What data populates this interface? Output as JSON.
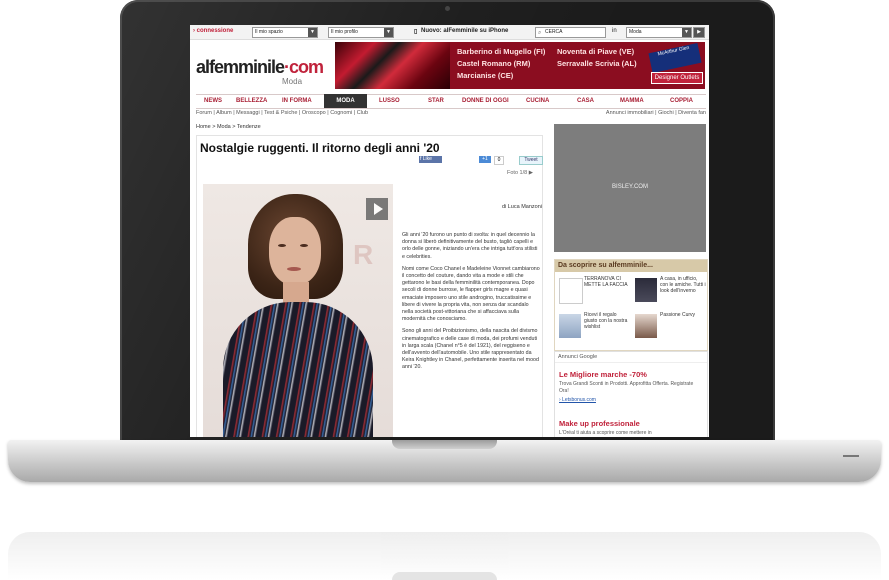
{
  "topbar": {
    "connect": "› connessione",
    "my_space": "Il mio spazio",
    "my_profile": "Il mio profilo",
    "iphone": "Nuovo: alFemminile su iPhone",
    "search": "CERCA",
    "in_label": "in",
    "category": "Moda"
  },
  "logo": {
    "text_a": "al",
    "text_b": "femminile",
    "text_c": "·com",
    "sub": "Moda"
  },
  "banner": {
    "line1a": "Barberino di Mugello (FI)",
    "line2a": "Castel Romano (RM)",
    "line3a": "Marcianise (CE)",
    "line1b": "Noventa di Piave (VE)",
    "line2b": "Serravalle Scrivia (AL)",
    "brand": "McArthur Glen",
    "outlet": "Designer Outlets"
  },
  "nav": [
    "NEWS",
    "BELLEZZA",
    "IN FORMA",
    "MODA",
    "LUSSO",
    "STAR",
    "DONNE DI OGGI",
    "CUCINA",
    "CASA",
    "MAMMA",
    "COPPIA"
  ],
  "subnav": {
    "left": "Forum | Album | Messaggi | Test & Psiche | Oroscopo | Cognomi | Club",
    "right": "Annunci immobiliari | Giochi | Diventa fan"
  },
  "breadcrumb": "Home > Moda > Tendenze",
  "article": {
    "title": "Nostalgie ruggenti. Il ritorno degli anni '20",
    "like": "Like",
    "plus_one": "+1",
    "plus_count": "0",
    "tweet": "Tweet",
    "foto": "Foto 1/8 ▶",
    "author": "di Luca Manzoni",
    "p1": "Gli anni '20 furono un punto di svolta: in quel decennio la donna si liberò definitivamente del busto, tagliò capelli e orlo delle gonne, iniziando un'era che intriga tutt'ora stilisti e celebrities.",
    "p2": "Nomi come Coco Chanel e Madeleine Vionnet cambiarono il concetto del couture, dando vita a mode e stili che gettarono le basi della femminilità contemporanea. Dopo secoli di donne burrose, le flapper girls magre e quasi emaciate imposero uno stile androgino, truccatissime e libere di vivere la propria vita, non senza dar scandalo nella società post-vittoriana che si affacciava sulla modernità che conosciamo.",
    "p3": "Sono gli anni del Proibizionismo, della nascita del divismo cinematografico e delle case di moda, dei profumi venduti in larga scala (Chanel n°5 è del 1921), del reggiseno e dell'avvento dell'automobile. Uno stile rappresentato da Keira Knightley in Chanel, perfettamente inserita nel mood anni '20."
  },
  "ad": {
    "label": "BISLEY.COM"
  },
  "discover": {
    "title": "Da scoprire su alfemminile...",
    "items": [
      {
        "text": "TERRANOVA CI METTE LA FACCIA"
      },
      {
        "text": "A casa, in ufficio, con le amiche. Tutti i look dell'inverno"
      },
      {
        "text": "Ricevi il regalo giusto con la nostra wishlist"
      },
      {
        "text": "Passione Curvy"
      }
    ]
  },
  "google": {
    "head": "Annunci Google",
    "t1": "Le Migliore marche -70%",
    "d1": "Trova Grandi Sconti in Prodotti. Approfitta Offerta. Registrate Ora!",
    "l1": "› Letsbonus.com",
    "t2": "Make up professionale",
    "d2": "L'Oréal ti aiuta a scoprire come mettere in"
  },
  "colors": {
    "brand": "#c0223b",
    "nav_active": "#333333",
    "banner": "#8b0d20"
  }
}
